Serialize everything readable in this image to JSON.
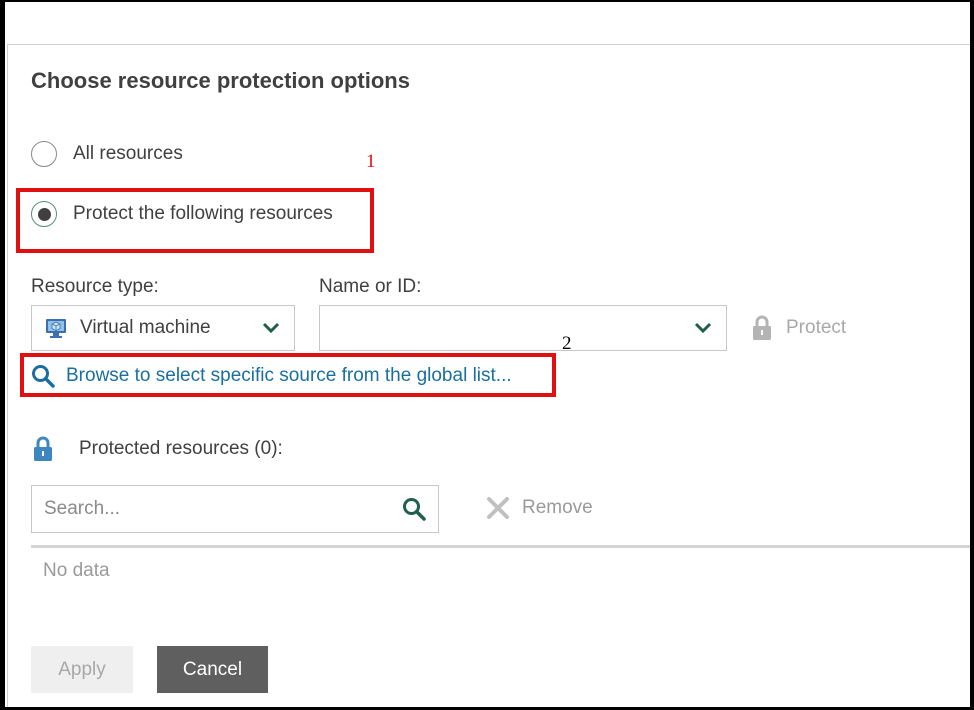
{
  "dialog": {
    "title": "Choose resource protection options"
  },
  "options": {
    "all_resources": "All resources",
    "protect_following": "Protect the following resources",
    "selected": "protect_following"
  },
  "annotations": {
    "label_1": "1",
    "label_2": "2",
    "color": "#e01010"
  },
  "resource_type": {
    "label": "Resource type:",
    "value": "Virtual machine",
    "icon": "virtual-machine-icon"
  },
  "name_or_id": {
    "label": "Name or ID:",
    "value": ""
  },
  "protect_button": {
    "label": "Protect",
    "icon": "lock-icon"
  },
  "browse": {
    "label": "Browse to select specific source from the global list...",
    "icon": "search-icon",
    "color": "#1a6f9e"
  },
  "protected_resources": {
    "label": "Protected resources (0):",
    "icon": "lock-icon"
  },
  "search": {
    "placeholder": "Search...",
    "value": ""
  },
  "remove_button": {
    "label": "Remove",
    "icon": "close-icon"
  },
  "table": {
    "empty_text": "No data"
  },
  "footer": {
    "apply": "Apply",
    "cancel": "Cancel"
  }
}
